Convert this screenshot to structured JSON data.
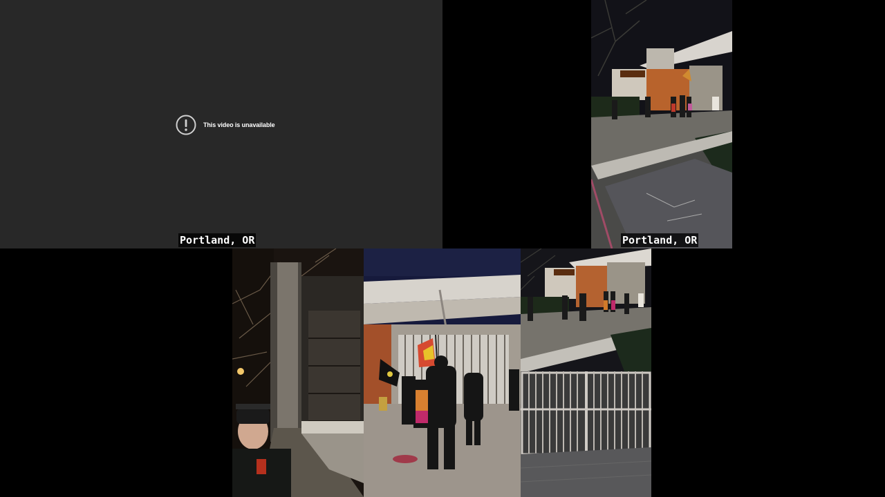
{
  "unavailable_panel": {
    "message": "This video is unavailable",
    "icon": "exclamation-circle-icon"
  },
  "captions": {
    "top_left": "Portland, OR",
    "top_right": "Portland, OR"
  },
  "frames": {
    "top_right": "night-building-protest-frame",
    "bottom_left": "street-selfie-frame",
    "bottom_center": "gate-flags-frame",
    "bottom_right_top": "building-wide-frame",
    "bottom_right_bottom": "metal-gate-frame"
  },
  "colors": {
    "panel_bg": "#282828",
    "background": "#000000",
    "caption_text": "#ffffff"
  }
}
